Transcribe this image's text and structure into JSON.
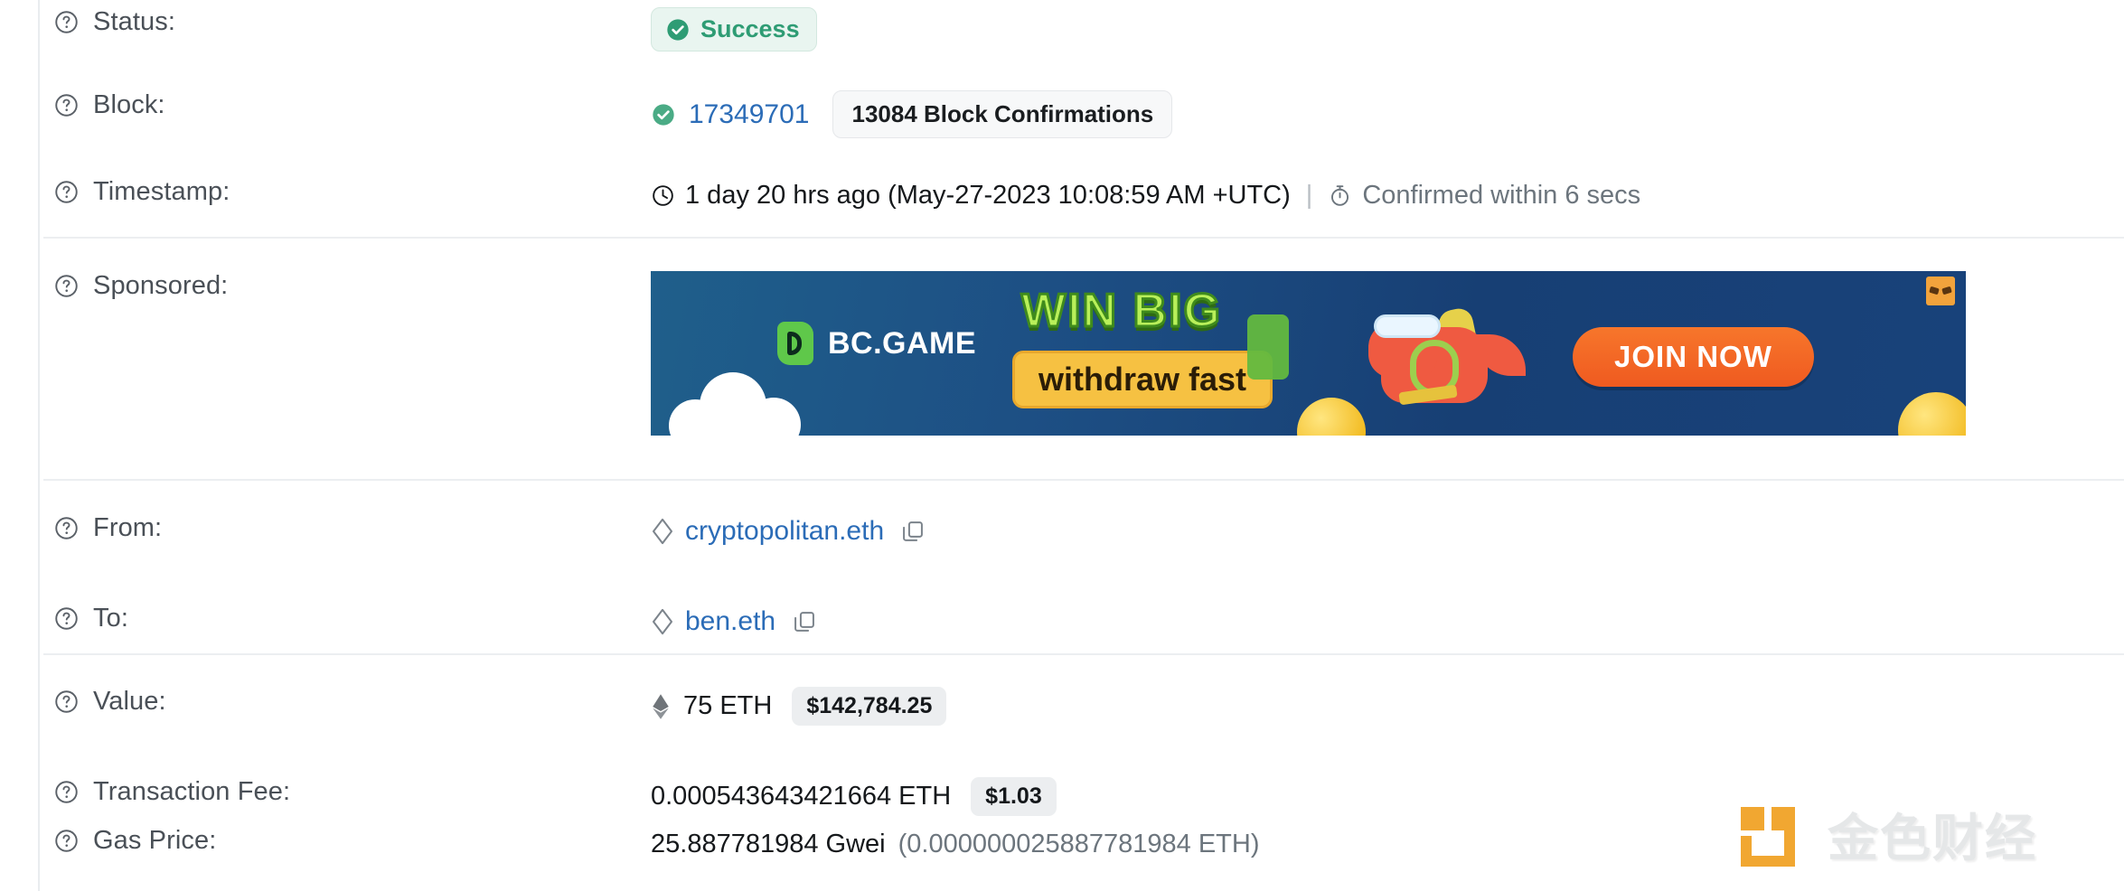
{
  "rows": {
    "status": {
      "label": "Status:",
      "badge": "Success",
      "help_icon": "question-circle-icon",
      "status_icon": "check-circle-icon"
    },
    "block": {
      "label": "Block:",
      "number": "17349701",
      "confirmations": "13084 Block Confirmations",
      "help_icon": "question-circle-icon",
      "status_icon": "check-circle-icon"
    },
    "timestamp": {
      "label": "Timestamp:",
      "relative": "1 day 20 hrs ago (May-27-2023 10:08:59 AM +UTC)",
      "separator": "|",
      "confirmed": "Confirmed within 6 secs",
      "clock_icon": "clock-icon",
      "stopwatch_icon": "stopwatch-icon",
      "help_icon": "question-circle-icon"
    },
    "sponsored": {
      "label": "Sponsored:",
      "help_icon": "question-circle-icon",
      "banner": {
        "brand": "BC.GAME",
        "headline": "WIN BIG",
        "subline": "withdraw fast",
        "cta": "JOIN NOW",
        "ad_icon": "ad-marker-icon",
        "mascot_icon": "dinosaur-mascot-icon",
        "colors": {
          "background": "#1d4f84",
          "headline": "#b9f05a",
          "subline_bg": "#f6c142",
          "cta_bg": "#ef5a20",
          "brand_mark": "#5fc84a"
        }
      }
    },
    "from": {
      "label": "From:",
      "address": "cryptopolitan.eth",
      "help_icon": "question-circle-icon",
      "ens_icon": "ens-diamond-icon",
      "copy_icon": "copy-icon"
    },
    "to": {
      "label": "To:",
      "address": "ben.eth",
      "help_icon": "question-circle-icon",
      "ens_icon": "ens-diamond-icon",
      "copy_icon": "copy-icon"
    },
    "value": {
      "label": "Value:",
      "amount": "75 ETH",
      "fiat": "$142,784.25",
      "help_icon": "question-circle-icon",
      "eth_icon": "ethereum-diamond-icon"
    },
    "transaction_fee": {
      "label": "Transaction Fee:",
      "amount": "0.000543643421664 ETH",
      "fiat": "$1.03",
      "help_icon": "question-circle-icon"
    },
    "gas_price": {
      "label": "Gas Price:",
      "gwei": "25.887781984 Gwei",
      "eth": "(0.000000025887781984 ETH)",
      "help_icon": "question-circle-icon"
    }
  },
  "watermark": {
    "text": "金色财经",
    "logo_icon": "jinse-logo-icon",
    "color": "#f0a020"
  },
  "colors": {
    "link": "#2b6cb7",
    "success": "#2e9c74",
    "success_bg": "#e9f5f0",
    "text": "#15181b",
    "label": "#4a5057",
    "muted": "#6c757d",
    "divider": "#eceef1",
    "pill_bg": "#eceef0"
  }
}
